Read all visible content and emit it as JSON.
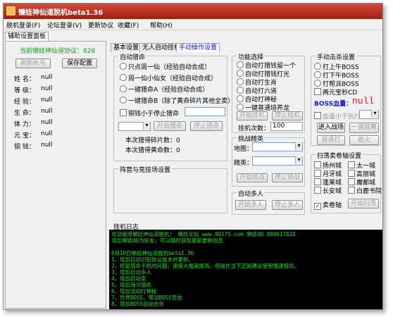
{
  "window": {
    "title": "懒娃神仙道脱机beta1.36"
  },
  "menu": [
    "脱机登录(F)",
    "论坛登录(V)",
    "更新协议",
    "收藏(F)",
    "帮助(H)"
  ],
  "left_panel": {
    "tab": "辅助设置面板",
    "protocol": "当前懒娃神仙道协议：828",
    "refresh_button": "刷新帐号",
    "save_button": "保存配置",
    "attributes": [
      {
        "label": "姓 名：",
        "value": "null"
      },
      {
        "label": "等 级：",
        "value": "null"
      },
      {
        "label": "经 验：",
        "value": "null"
      },
      {
        "label": "生 命：",
        "value": "null"
      },
      {
        "label": "体 力：",
        "value": "null"
      },
      {
        "label": "元 宝：",
        "value": "null"
      },
      {
        "label": "铜 钱：",
        "value": "null"
      }
    ]
  },
  "tabs": [
    "基本设置",
    "无人自动挂机",
    "手动操作设置"
  ],
  "immortal": {
    "title": "自动猎命",
    "options": [
      "只点周一仙（经验自动合成）",
      "周一仙小仙女（经验自动合成）",
      "一键猎命A（经验自动合成）",
      "一键猎命B（除了黄命碎片其他全卖）"
    ],
    "stop_check": "铜钱小于停止猎命",
    "start_btn": "开始猎命",
    "stop_btn": "停止猎命",
    "fragments": "本次猎得碎片数：0",
    "gold": "本次猎得黄命数：0"
  },
  "camp": {
    "title": "阵营与竞技场设置"
  },
  "function": {
    "title": "功能选择",
    "options": [
      "自动打猎钱留一个",
      "自动打猎钱打光",
      "自动打生肖",
      "自动打六道",
      "自动打神秘",
      "一键普通培养龙"
    ],
    "start_btn": "开始挂机",
    "stop_btn": "停止挂机",
    "count_label": "挂机次数：",
    "count_value": "100"
  },
  "challenge": {
    "title": "挑战精英",
    "map_label": "地图：",
    "elite_label": "精英：",
    "start_btn": "开始挑战",
    "stop_btn": "停止挑战"
  },
  "multiplayer": {
    "title": "自动多人",
    "start_btn": "开始多人",
    "stop_btn": "停止多人"
  },
  "boss": {
    "title": "手动击杀设置",
    "options": [
      "打上午BOSS",
      "打下午BOSS",
      "打帮派BOSS",
      "两元宝秒CD"
    ],
    "hp_label": "BOSS血量：",
    "hp_value": "null",
    "exec_check": "血量小于执行",
    "enter_btn": "进入战场",
    "one_key_btn": "一键鼓舞",
    "cheer_btn": "管退打",
    "fall_btn": "欲火"
  },
  "sweep": {
    "title": "扫荡卖卷轴设置",
    "cities": [
      "扬州城",
      "太一城",
      "月牙城",
      "高丽城",
      "蓬莱城",
      "魔都城",
      "长安城",
      "白鹿书院"
    ],
    "sell_check": "卖卷轴",
    "start_btn": "开始扫荡"
  },
  "log": {
    "title": "挂机日志",
    "lines": [
      "欢迎使用懒娃神仙道脱机！ 懒娃论坛 www.00175.com  懒娃QQ 800017828",
      "添加懒娃QQ为好友，可以随时获取最新更新信息",
      "",
      "6月10日懒娃神仙道脱机beta1.36",
      "1，增加自动识别协议版本并更新。",
      "2，修复猎命卡机的问题，速度大幅度提高。但是在当下还是建议使用慢速猎命。",
      "3，增加自动多人",
      "4，增加自动卖",
      "5，增加海贝猎命",
      "6，增加活动打神秘",
      "7，世界BOSS，帮派BOSS显血",
      "8，增加BOSS自动击杀"
    ]
  }
}
